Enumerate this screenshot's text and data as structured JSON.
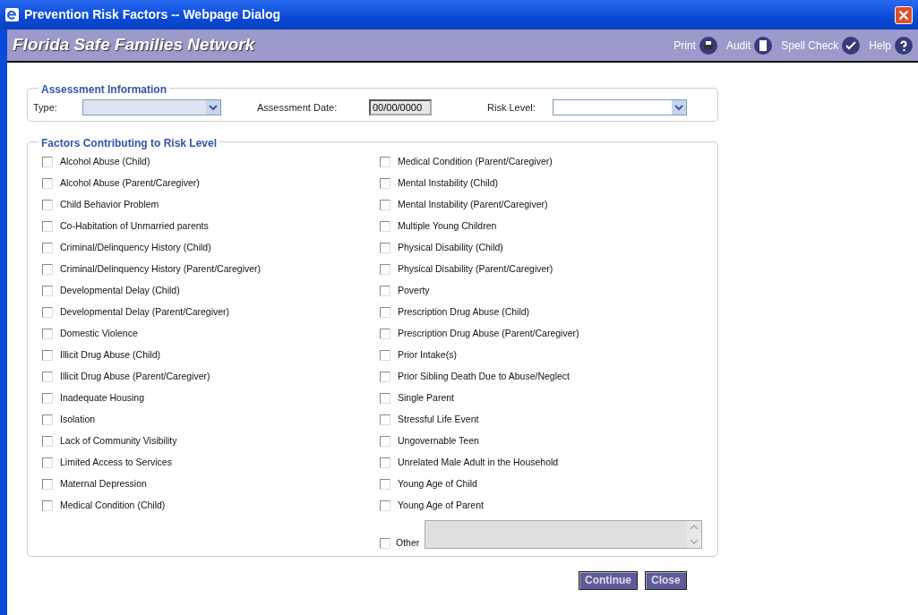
{
  "window": {
    "title": "Prevention Risk Factors -- Webpage Dialog"
  },
  "header": {
    "brand": "Florida Safe Families Network",
    "tools": [
      {
        "label": "Print",
        "kind": "print"
      },
      {
        "label": "Audit",
        "kind": "audit"
      },
      {
        "label": "Spell Check",
        "kind": "spell"
      },
      {
        "label": "Help",
        "kind": "help"
      }
    ]
  },
  "assessment": {
    "legend": "Assessment Information",
    "type_label": "Type:",
    "date_label": "Assessment Date:",
    "date_value": "00/00/0000",
    "risk_label": "Risk Level:"
  },
  "factors": {
    "legend": "Factors Contributing to Risk Level",
    "left": [
      {
        "label": "Alcohol Abuse (Child)",
        "checked": false
      },
      {
        "label": "Alcohol Abuse (Parent/Caregiver)",
        "checked": false
      },
      {
        "label": "Child Behavior Problem",
        "checked": false
      },
      {
        "label": "Co-Habitation of Unmarried parents",
        "checked": false
      },
      {
        "label": "Criminal/Delinquency History (Child)",
        "checked": false
      },
      {
        "label": "Criminal/Delinquency History (Parent/Caregiver)",
        "checked": false
      },
      {
        "label": "Developmental Delay (Child)",
        "checked": false
      },
      {
        "label": "Developmental Delay (Parent/Caregiver)",
        "checked": false
      },
      {
        "label": "Domestic Violence",
        "checked": false
      },
      {
        "label": "Illicit Drug Abuse (Child)",
        "checked": false
      },
      {
        "label": "Illicit Drug Abuse (Parent/Caregiver)",
        "checked": false
      },
      {
        "label": "Inadequate Housing",
        "checked": false
      },
      {
        "label": "Isolation",
        "checked": false
      },
      {
        "label": "Lack of Community Visibility",
        "checked": false
      },
      {
        "label": "Limited Access to Services",
        "checked": false
      },
      {
        "label": "Maternal Depression",
        "checked": false
      },
      {
        "label": "Medical Condition (Child)",
        "checked": false
      }
    ],
    "right": [
      {
        "label": "Medical Condition (Parent/Caregiver)",
        "checked": false
      },
      {
        "label": "Mental Instability (Child)",
        "checked": false
      },
      {
        "label": "Mental Instability (Parent/Caregiver)",
        "checked": false
      },
      {
        "label": "Multiple Young Children",
        "checked": false
      },
      {
        "label": "Physical Disability (Child)",
        "checked": false
      },
      {
        "label": "Physical Disability (Parent/Caregiver)",
        "checked": false
      },
      {
        "label": "Poverty",
        "checked": false
      },
      {
        "label": "Prescription Drug Abuse (Child)",
        "checked": false
      },
      {
        "label": "Prescription Drug Abuse (Parent/Caregiver)",
        "checked": false
      },
      {
        "label": "Prior Intake(s)",
        "checked": false
      },
      {
        "label": "Prior Sibling Death Due to Abuse/Neglect",
        "checked": false
      },
      {
        "label": "Single Parent",
        "checked": false
      },
      {
        "label": "Stressful Life Event",
        "checked": false
      },
      {
        "label": "Ungovernable Teen",
        "checked": false
      },
      {
        "label": "Unrelated Male Adult in the Household",
        "checked": false
      },
      {
        "label": "Young Age of Child",
        "checked": false
      },
      {
        "label": "Young Age of Parent",
        "checked": false
      }
    ],
    "other": {
      "label": "Other",
      "checked": false
    }
  },
  "buttons": [
    {
      "label": "Continue"
    },
    {
      "label": "Close"
    }
  ]
}
